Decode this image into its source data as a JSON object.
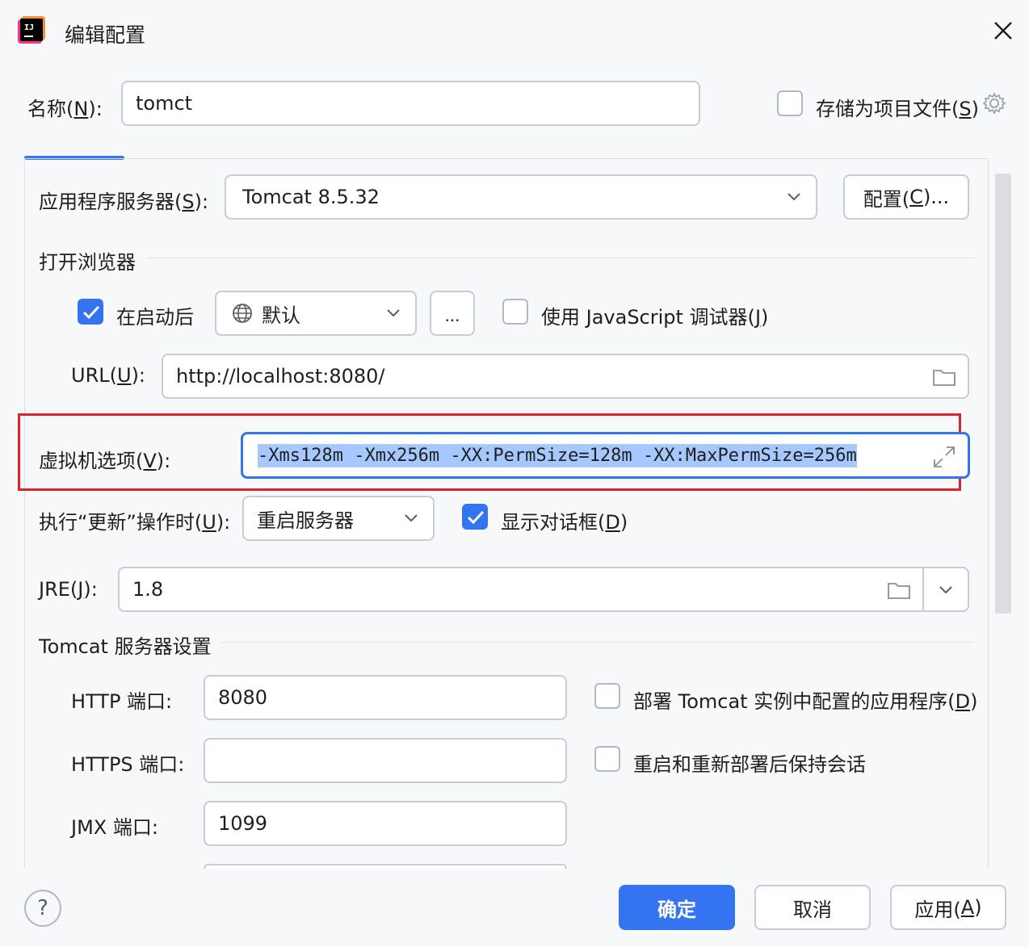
{
  "window": {
    "title": "编辑配置"
  },
  "name_row": {
    "label_pre": "名称(",
    "label_key": "N",
    "label_post": "):",
    "value": "tomct",
    "store_label_pre": "存储为项目文件(",
    "store_label_key": "S",
    "store_label_post": ")",
    "store_checked": false
  },
  "server": {
    "label_pre": "应用程序服务器(",
    "label_key": "S",
    "label_post": "):",
    "value": "Tomcat 8.5.32",
    "configure_pre": "配置(",
    "configure_key": "C",
    "configure_post": ")..."
  },
  "browser": {
    "section_title": "打开浏览器",
    "after_launch_label": "在启动后",
    "after_launch_checked": true,
    "browser_value": "默认",
    "more_button": "...",
    "js_debugger_pre": "使用 JavaScript 调试器(",
    "js_debugger_key": "J",
    "js_debugger_post": ")",
    "js_debugger_checked": false,
    "url_label_pre": "URL(",
    "url_label_key": "U",
    "url_label_post": "):",
    "url_value": "http://localhost:8080/"
  },
  "vm_options": {
    "label_pre": "虚拟机选项(",
    "label_key": "V",
    "label_post": "):",
    "value": "-Xms128m -Xmx256m -XX:PermSize=128m -XX:MaxPermSize=256m"
  },
  "on_update": {
    "label_pre": "执行“更新”操作时(",
    "label_key": "U",
    "label_post": "):",
    "value": "重启服务器",
    "show_dialog_pre": "显示对话框(",
    "show_dialog_key": "D",
    "show_dialog_post": ")",
    "show_dialog_checked": true
  },
  "jre": {
    "label_pre": "JRE(",
    "label_key": "J",
    "label_post": "):",
    "value": "1.8"
  },
  "tomcat_settings": {
    "section_title": "Tomcat 服务器设置",
    "http_port_label": "HTTP 端口:",
    "http_port_value": "8080",
    "https_port_label": "HTTPS 端口:",
    "https_port_value": "",
    "jmx_port_label": "JMX 端口:",
    "jmx_port_value": "1099",
    "deploy_apps_pre": "部署 Tomcat 实例中配置的应用程序(",
    "deploy_apps_key": "D",
    "deploy_apps_post": ")",
    "deploy_apps_checked": false,
    "preserve_sessions_label": "重启和重新部署后保持会话",
    "preserve_sessions_checked": false
  },
  "footer": {
    "help": "?",
    "ok": "确定",
    "cancel": "取消",
    "apply_pre": "应用(",
    "apply_key": "A",
    "apply_post": ")"
  },
  "colors": {
    "accent": "#3574f0",
    "highlight_border": "#e2222a",
    "selection": "#a6c8ff"
  }
}
